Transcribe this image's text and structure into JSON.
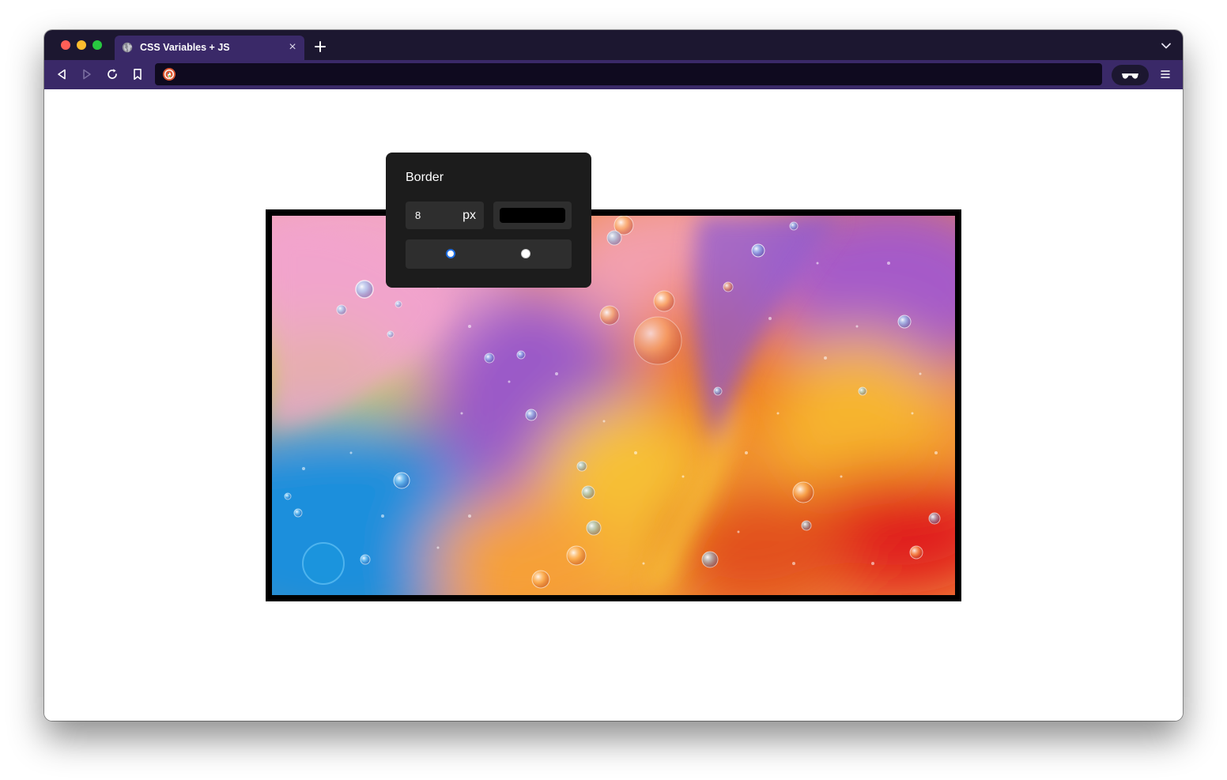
{
  "browser": {
    "tab_title": "CSS Variables + JS",
    "tab_close": "×",
    "url": "",
    "theme": {
      "tabbar": "#1c1730",
      "toolbar": "#3a2968",
      "urlbar": "#0f0a1f"
    }
  },
  "page": {
    "image_border_color": "#000000",
    "popover": {
      "title": "Border",
      "width_value": "8",
      "width_unit": "px",
      "color_value": "#000000",
      "radio_options": [
        {
          "selected": true
        },
        {
          "selected": false
        }
      ]
    }
  }
}
